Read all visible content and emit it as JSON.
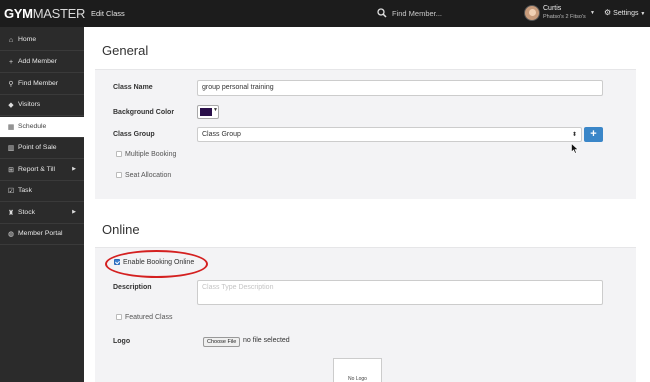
{
  "app": {
    "logo_part1": "GYM",
    "logo_part2": "MASTER",
    "page_heading": "Edit Class"
  },
  "header": {
    "search_icon": "search-icon",
    "search_placeholder": "Find Member...",
    "user_name": "Curtis",
    "user_sub": "Phatso's 2 Fitso's",
    "user_caret": "▼",
    "settings_label": "Settings",
    "settings_icon": "gear-icon",
    "settings_caret": "▼"
  },
  "sidebar": {
    "items": [
      {
        "label": "Home",
        "icon": "home-icon",
        "glyph": "⌂",
        "has_arrow": false
      },
      {
        "label": "Add Member",
        "icon": "plus-icon",
        "glyph": "+",
        "has_arrow": false
      },
      {
        "label": "Find Member",
        "icon": "search-icon",
        "glyph": "⚲",
        "has_arrow": false
      },
      {
        "label": "Visitors",
        "icon": "tag-icon",
        "glyph": "◆",
        "has_arrow": false
      },
      {
        "label": "Schedule",
        "icon": "calendar-icon",
        "glyph": "▦",
        "has_arrow": false,
        "active": true
      },
      {
        "label": "Point of Sale",
        "icon": "barcode-icon",
        "glyph": "▥",
        "has_arrow": false
      },
      {
        "label": "Report & Till",
        "icon": "cart-icon",
        "glyph": "⊞",
        "has_arrow": true
      },
      {
        "label": "Task",
        "icon": "check-square-icon",
        "glyph": "☑",
        "has_arrow": false
      },
      {
        "label": "Stock",
        "icon": "trophy-icon",
        "glyph": "♜",
        "has_arrow": true
      },
      {
        "label": "Member Portal",
        "icon": "globe-icon",
        "glyph": "◍",
        "has_arrow": false
      }
    ],
    "arrow_glyph": "▶"
  },
  "general": {
    "title": "General",
    "class_name_label": "Class Name",
    "class_name_value": "group personal training",
    "background_color_label": "Background Color",
    "background_color_value": "#2a0f4a",
    "color_caret": "▼",
    "class_group_label": "Class Group",
    "class_group_value": "Class Group",
    "select_arrows": "⬍",
    "add_group_label": "+",
    "multiple_booking_label": "Multiple Booking",
    "multiple_booking_checked": false,
    "seat_allocation_label": "Seat Allocation",
    "seat_allocation_checked": false
  },
  "online": {
    "title": "Online",
    "enable_booking_label": "Enable Booking Online",
    "enable_booking_checked": true,
    "description_label": "Description",
    "description_placeholder": "Class Type Description",
    "description_value": "",
    "featured_class_label": "Featured Class",
    "featured_class_checked": false,
    "logo_label": "Logo",
    "choose_file_label": "Choose File",
    "file_status": "no file selected",
    "logo_placeholder": "No Logo"
  },
  "colors": {
    "topbar": "#1c1c1c",
    "sidebar": "#2b2b2b",
    "accent_blue": "#3a86c8",
    "highlight_red": "#d42020"
  }
}
